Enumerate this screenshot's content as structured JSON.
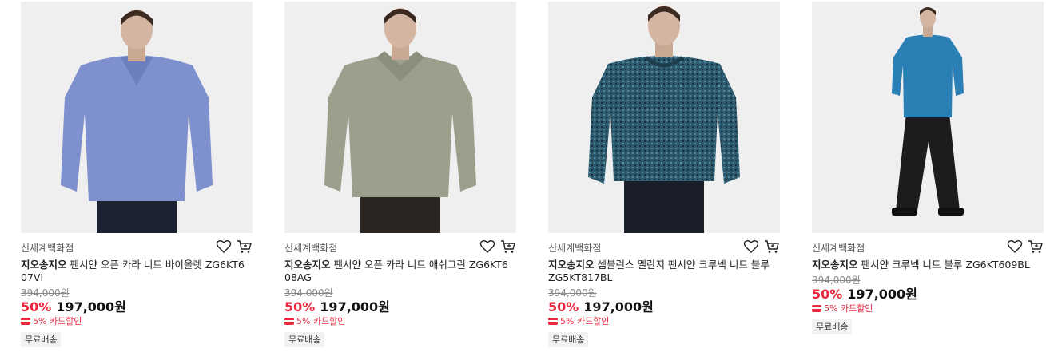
{
  "products": [
    {
      "store": "신세계백화점",
      "brand": "지오송지오",
      "name": " 팬시얀 오픈 카라 니트 바이올렛 ZG6KT607VI",
      "original_price": "394,000원",
      "discount": "50%",
      "price": "197,000원",
      "card_discount": "5% 카드할인",
      "badge": "무료배송",
      "sweater_color": "#7f90cf",
      "pants_color": "#1d2233"
    },
    {
      "store": "신세계백화점",
      "brand": "지오송지오",
      "name": " 팬시얀 오픈 카라 니트 애쉬그린 ZG6KT608AG",
      "original_price": "394,000원",
      "discount": "50%",
      "price": "197,000원",
      "card_discount": "5% 카드할인",
      "badge": "무료배송",
      "sweater_color": "#9b9f8c",
      "pants_color": "#2b2622"
    },
    {
      "store": "신세계백화점",
      "brand": "지오송지오",
      "name": " 셈블런스 멜란지 팬시얀 크루넥 니트 블루 ZG5KT817BL",
      "original_price": "394,000원",
      "discount": "50%",
      "price": "197,000원",
      "card_discount": "5% 카드할인",
      "badge": "무료배송",
      "sweater_color": "#2e5a6e",
      "pants_color": "#1b1f2a"
    },
    {
      "store": "신세계백화점",
      "brand": "지오송지오",
      "name": " 팬시얀 크루넥 니트 블루 ZG6KT609BL",
      "original_price": "394,000원",
      "discount": "50%",
      "price": "197,000원",
      "card_discount": "5% 카드할인",
      "badge": "무료배송",
      "sweater_color": "#2a7fb5",
      "pants_color": "#1c1c1e"
    }
  ]
}
